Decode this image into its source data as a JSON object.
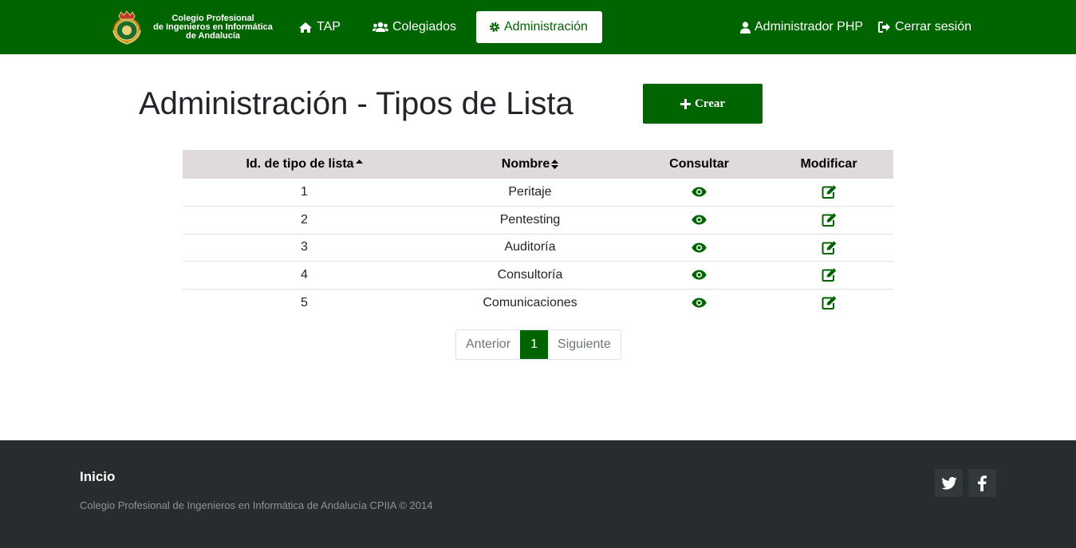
{
  "navbar": {
    "brand_line1": "Colegio Profesional",
    "brand_line2": "de Ingenieros en Informática",
    "brand_line3": "de Andalucía",
    "tap": "TAP",
    "colegiados": "Colegiados",
    "administracion": "Administración",
    "user": "Administrador PHP",
    "logout": "Cerrar sesión"
  },
  "header": {
    "title": "Administración - Tipos de Lista",
    "create_label": "Crear"
  },
  "table": {
    "headers": {
      "id": "Id. de tipo de lista",
      "name": "Nombre",
      "consult": "Consultar",
      "modify": "Modificar"
    },
    "rows": [
      {
        "id": "1",
        "name": "Peritaje"
      },
      {
        "id": "2",
        "name": "Pentesting"
      },
      {
        "id": "3",
        "name": "Auditoría"
      },
      {
        "id": "4",
        "name": "Consultoría"
      },
      {
        "id": "5",
        "name": "Comunicaciones"
      }
    ]
  },
  "pagination": {
    "prev": "Anterior",
    "current": "1",
    "next": "Siguiente"
  },
  "footer": {
    "title": "Inicio",
    "copyright": "Colegio Profesional de Ingenieros en Informática de Andalucía CPIIA © 2014"
  },
  "icons": {
    "home": "home-icon",
    "users": "users-icon",
    "cog": "cog-icon",
    "user": "user-icon",
    "logout": "sign-out-icon",
    "plus": "plus-icon",
    "view": "eye-icon",
    "edit": "edit-icon",
    "twitter": "twitter-icon",
    "facebook": "facebook-icon"
  },
  "colors": {
    "primary": "#006400",
    "header_row": "#e1dada",
    "footer_bg": "#292c2f"
  }
}
